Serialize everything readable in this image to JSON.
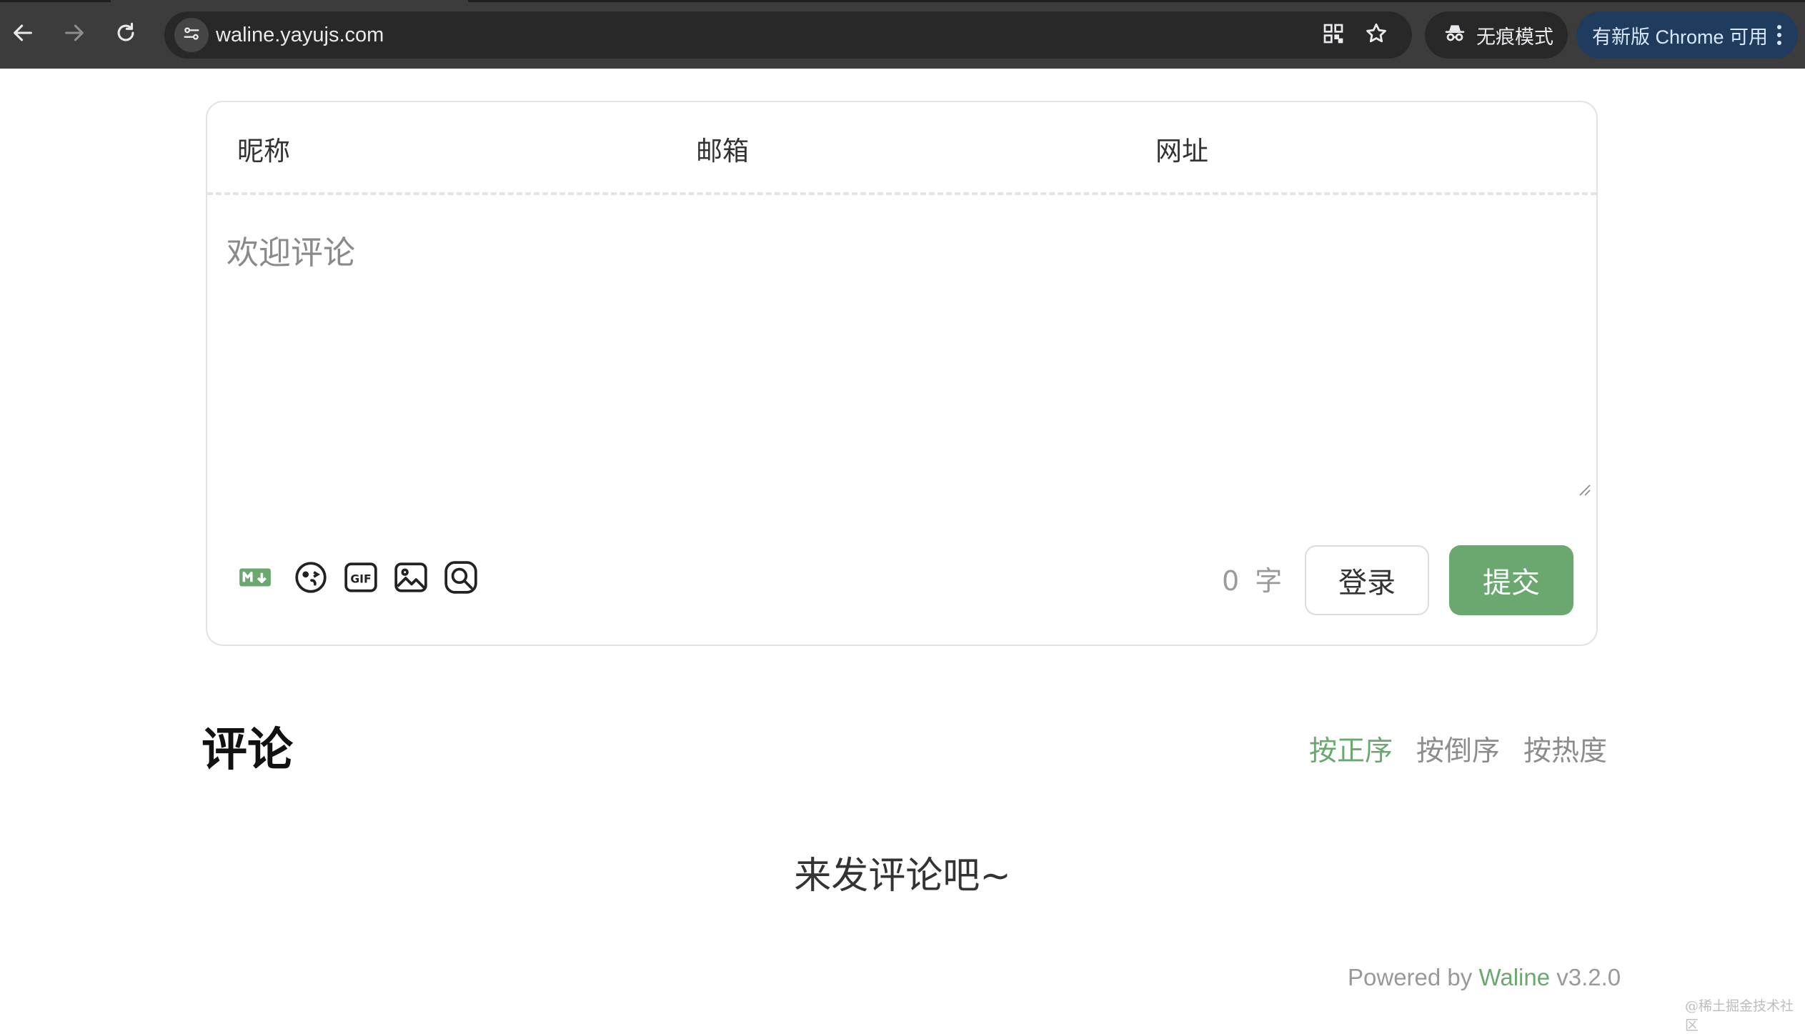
{
  "browser": {
    "url": "waline.yayujs.com",
    "incognito_label": "无痕模式",
    "update_label": "有新版 Chrome 可用",
    "icons": [
      "back-icon",
      "forward-icon",
      "reload-icon",
      "site-info-icon",
      "qr-code-icon",
      "bookmark-star-icon",
      "incognito-icon",
      "menu-dots-icon"
    ]
  },
  "form": {
    "nick_label": "昵称",
    "mail_label": "邮箱",
    "link_label": "网址",
    "textarea_placeholder": "欢迎评论",
    "toolbar_icons": [
      "markdown-icon",
      "emoji-icon",
      "gif-icon",
      "image-icon",
      "preview-icon"
    ],
    "word_count": "0",
    "word_unit": "字",
    "login_label": "登录",
    "submit_label": "提交"
  },
  "comments": {
    "title": "评论",
    "sort_options": [
      {
        "label": "按正序",
        "active": true
      },
      {
        "label": "按倒序",
        "active": false
      },
      {
        "label": "按热度",
        "active": false
      }
    ],
    "empty_text": "来发评论吧~"
  },
  "footer": {
    "powered_prefix": "Powered by",
    "brand": "Waline",
    "version": "v3.2.0"
  },
  "watermark": "@稀土掘金技术社区",
  "colors": {
    "accent": "#6aa86f",
    "chrome_bg": "#3c3c3c",
    "update_pill": "#1f3b5e"
  }
}
